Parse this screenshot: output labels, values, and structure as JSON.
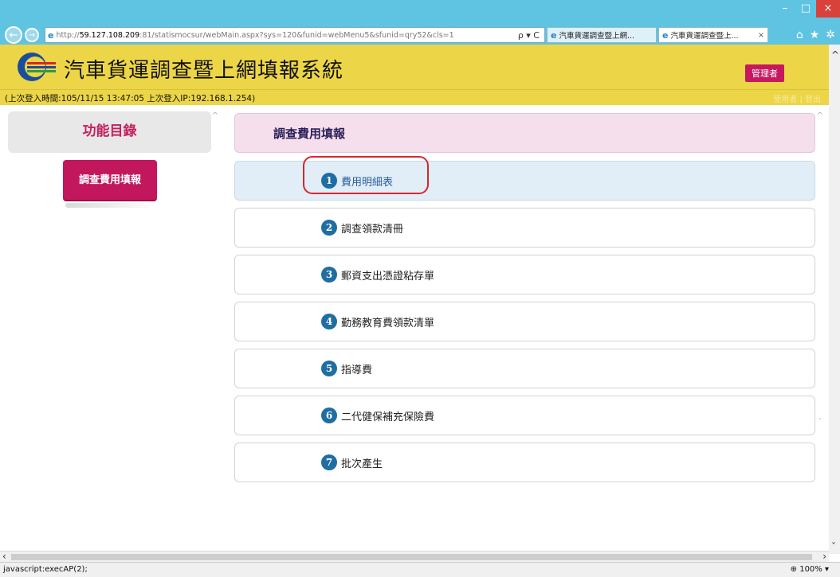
{
  "browser": {
    "url_prefix": "http://",
    "url_host": "59.127.108.209",
    "url_rest": ":81/statismocsur/webMain.aspx?sys=120&funid=webMenu5&sfunid=qry52&cls=1",
    "url_tools": "ρ ▾ C",
    "tabs": [
      {
        "title": "汽車貨運調查暨上網..."
      },
      {
        "title": "汽車貨運調查暨上...",
        "close": "×"
      }
    ]
  },
  "header": {
    "title": "汽車貨運調查暨上網填報系統",
    "admin_label": "管理者",
    "last_login": "(上次登入時間:105/11/15 13:47:05 上次登入IP:192.168.1.254)",
    "faded_links": "使用者 | 登出"
  },
  "sidebar": {
    "title": "功能目錄",
    "button_label": "調查費用填報"
  },
  "main": {
    "title": "調查費用填報",
    "items": [
      {
        "num": "1",
        "label": "費用明細表"
      },
      {
        "num": "2",
        "label": "調查領款清冊"
      },
      {
        "num": "3",
        "label": "郵資支出憑證粘存單"
      },
      {
        "num": "4",
        "label": "勤務教育費領款清單"
      },
      {
        "num": "5",
        "label": "指導費"
      },
      {
        "num": "6",
        "label": "二代健保補充保險費"
      },
      {
        "num": "7",
        "label": "批次產生"
      }
    ]
  },
  "status": {
    "text": "javascript:execAP(2);",
    "zoom": "100%"
  },
  "colors": {
    "header_bg": "#ecd546",
    "accent": "#c2175d",
    "highlight": "#d9262c"
  }
}
